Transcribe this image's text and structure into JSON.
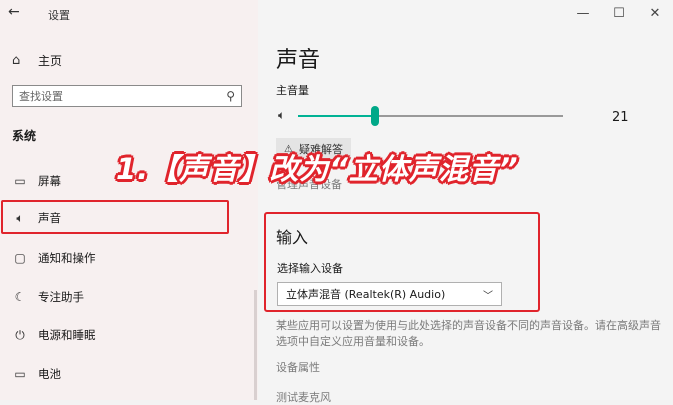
{
  "titlebar": {
    "back_icon": "back-arrow-icon",
    "app_title": "设置"
  },
  "window_controls": {
    "minimize": "—",
    "maximize": "☐",
    "close": "✕"
  },
  "sidebar": {
    "home_label": "主页",
    "search_placeholder": "查找设置",
    "section": "系统",
    "items": [
      {
        "label": "屏幕",
        "icon": "monitor-icon"
      },
      {
        "label": "声音",
        "icon": "speaker-icon",
        "highlighted": true
      },
      {
        "label": "通知和操作",
        "icon": "notification-icon"
      },
      {
        "label": "专注助手",
        "icon": "moon-icon"
      },
      {
        "label": "电源和睡眠",
        "icon": "power-icon"
      },
      {
        "label": "电池",
        "icon": "battery-icon"
      }
    ]
  },
  "main": {
    "title": "声音",
    "master_volume_label": "主音量",
    "volume_value": "21",
    "volume_level": 0.29,
    "troubleshoot_label": "疑难解答",
    "manage_link": "管理声音设备",
    "input": {
      "title": "输入",
      "device_label": "选择输入设备",
      "device_value": "立体声混音 (Realtek(R) Audio)",
      "description": "某些应用可以设置为使用与此处选择的声音设备不同的声音设备。请在高级声音选项中自定义应用音量和设备。",
      "properties_link": "设备属性",
      "mic_test_link": "测试麦克风"
    }
  },
  "overlay": {
    "caption": "1.【声音】改为“立体声混音”",
    "color": "#e0242c"
  },
  "colors": {
    "accent": "#00b294",
    "highlight_border": "#e0242c"
  }
}
